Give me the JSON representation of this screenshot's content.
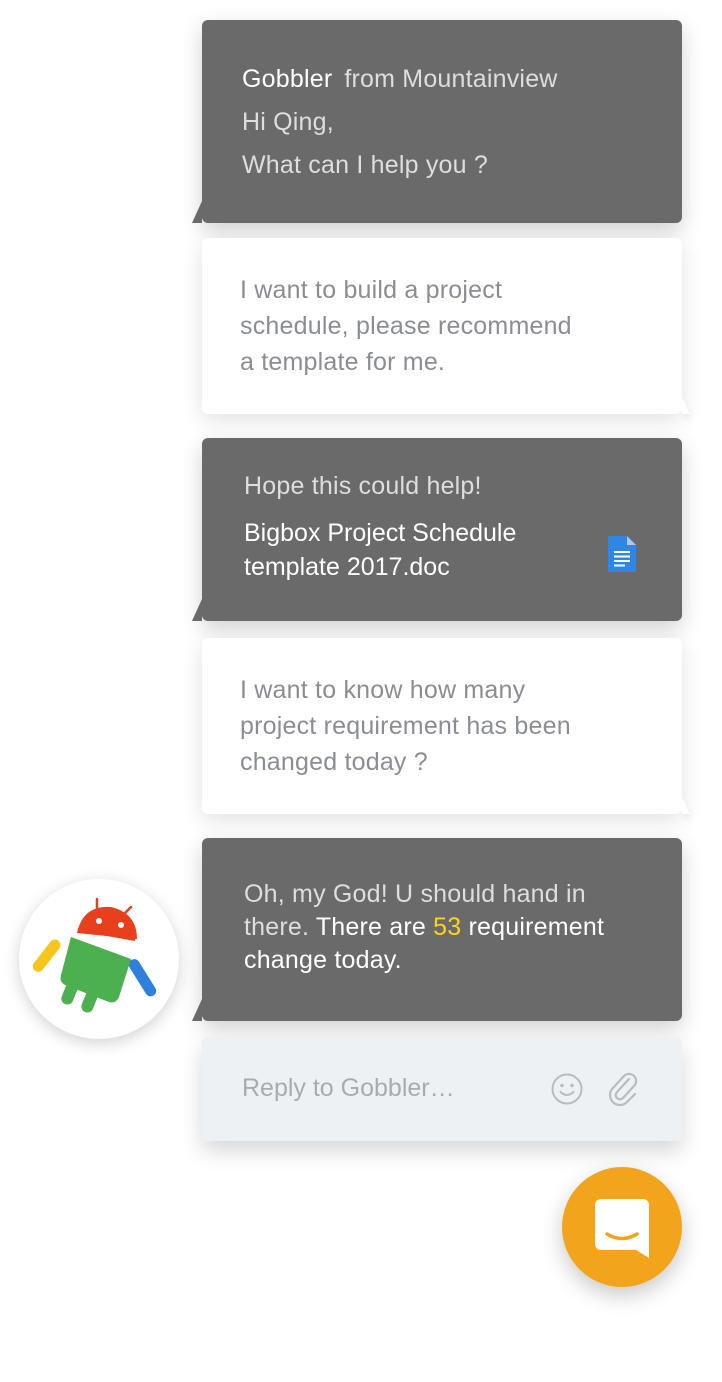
{
  "agent": {
    "name": "Gobbler",
    "location": "from Mountainview"
  },
  "messages": [
    {
      "id": "m1",
      "role": "bot",
      "lines": [
        "Hi Qing,",
        "What can I help you ?"
      ]
    },
    {
      "id": "m2",
      "role": "user",
      "lines": [
        "I want to build a project",
        "schedule, please recommend",
        "a template for me."
      ]
    },
    {
      "id": "m3",
      "role": "bot",
      "intro": "Hope this could help!",
      "attachment": {
        "title_lines": [
          "Bigbox Project Schedule",
          "template 2017.doc"
        ],
        "icon": "google-doc-icon",
        "icon_color": "#2f86e6"
      }
    },
    {
      "id": "m4",
      "role": "user",
      "lines": [
        "I want to know how many",
        "project requirement has been",
        "changed today ?"
      ]
    },
    {
      "id": "m5",
      "role": "bot",
      "line1": "Oh, my God!  U should hand in",
      "line2_part1": "there.",
      "line2_part2": " There are ",
      "line2_number": "53",
      "line2_part3": " requirement",
      "line3": "change today."
    }
  ],
  "reply": {
    "placeholder": "Reply to Gobbler…",
    "emoji_icon": "smiley-icon",
    "attach_icon": "paperclip-icon"
  },
  "launcher": {
    "icon": "chat-bubble-icon"
  },
  "colors": {
    "bot_bubble": "#6a6a6a",
    "user_bubble": "#ffffff",
    "highlight_number": "#ffd21e",
    "launcher": "#f2a51c",
    "reply_bar": "#eef1f4"
  }
}
